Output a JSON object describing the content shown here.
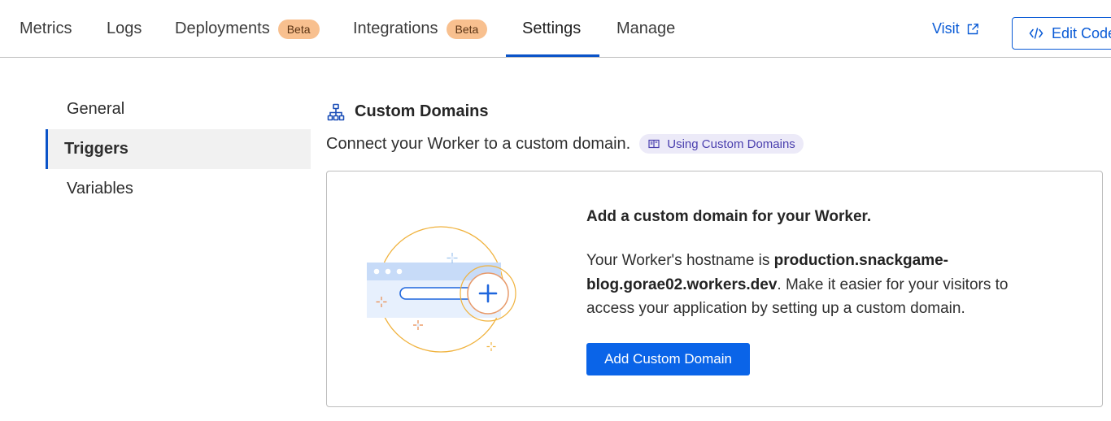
{
  "tabs": [
    {
      "label": "Metrics"
    },
    {
      "label": "Logs"
    },
    {
      "label": "Deployments",
      "badge": "Beta"
    },
    {
      "label": "Integrations",
      "badge": "Beta"
    },
    {
      "label": "Settings",
      "active": true
    },
    {
      "label": "Manage"
    }
  ],
  "actions": {
    "visit_label": "Visit",
    "edit_code_label": "Edit Code"
  },
  "sidenav": {
    "items": [
      {
        "label": "General"
      },
      {
        "label": "Triggers",
        "active": true
      },
      {
        "label": "Variables"
      }
    ]
  },
  "section": {
    "title": "Custom Domains",
    "description": "Connect your Worker to a custom domain.",
    "doc_link": "Using Custom Domains"
  },
  "card": {
    "heading": "Add a custom domain for your Worker.",
    "body_prefix": "Your Worker's hostname is ",
    "hostname": "production.snackgame-blog.gorae02.workers.dev",
    "body_suffix": ". Make it easier for your visitors to access your application by setting up a custom domain.",
    "button_label": "Add Custom Domain"
  },
  "colors": {
    "accent": "#0a53c8",
    "primary_button": "#0a64e8",
    "beta_badge": "#f8c08f",
    "doc_pill_bg": "#eceaf8"
  },
  "icons": {
    "visit": "external-link-icon",
    "edit_code": "code-icon",
    "section": "sitemap-icon",
    "doc": "book-icon"
  }
}
